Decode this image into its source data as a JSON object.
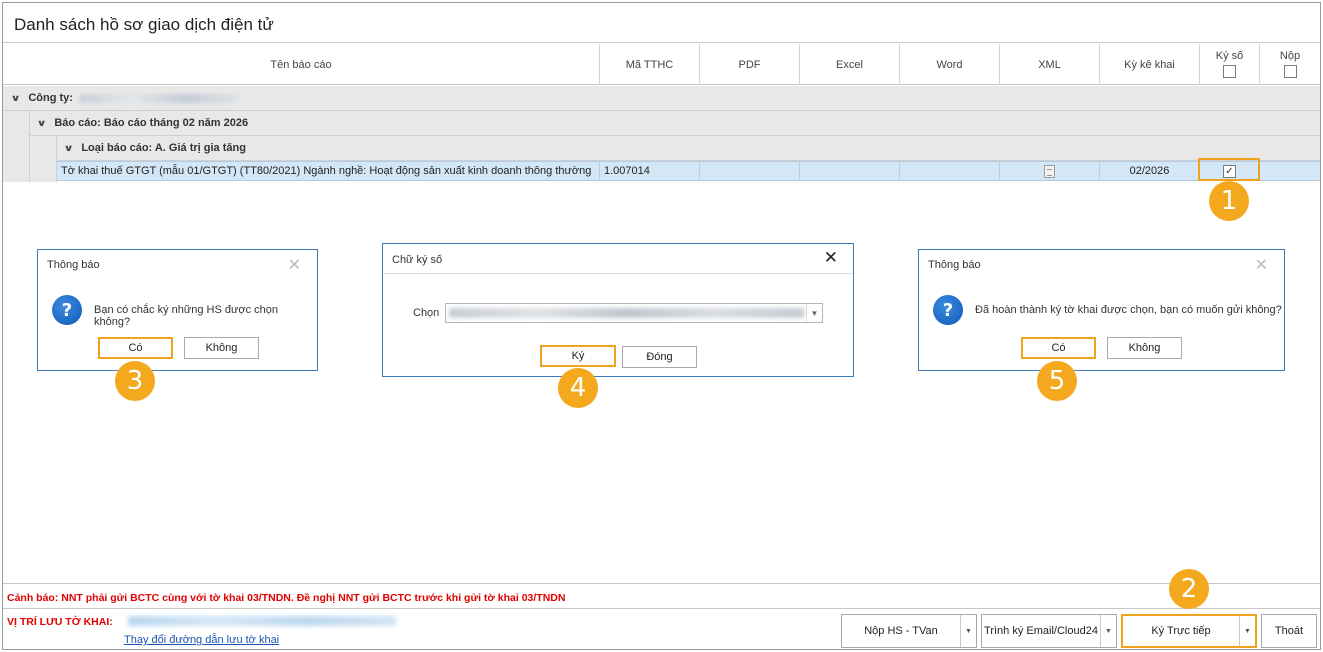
{
  "window": {
    "title": "Danh sách hồ sơ giao dịch điện tử"
  },
  "columns": {
    "ten_bao_cao": "Tên báo cáo",
    "ma_tthc": "Mã TTHC",
    "pdf": "PDF",
    "excel": "Excel",
    "word": "Word",
    "xml": "XML",
    "ky_ke_khai": "Kỳ kê khai",
    "ky_so": "Ký số",
    "nop": "Nộp"
  },
  "groups": {
    "cong_ty_label": "Công ty:",
    "bao_cao_label": "Báo cáo: Báo cáo tháng 02 năm 2026",
    "loai_bao_cao_label": "Loại báo cáo: A. Giá trị gia tăng"
  },
  "row": {
    "ten": "Tờ khai thuế GTGT (mẫu 01/GTGT) (TT80/2021) Ngành nghề: Hoạt động sản xuất kinh doanh thông thường",
    "ma_tthc": "1.007014",
    "ky_ke_khai": "02/2026",
    "ky_so_checked": "✓"
  },
  "badges": {
    "b1": "1",
    "b2": "2",
    "b3": "3",
    "b4": "4",
    "b5": "5"
  },
  "dialog1": {
    "title": "Thông báo",
    "message": "Bạn có chắc ký những HS được chọn không?",
    "yes": "Có",
    "no": "Không"
  },
  "dialog2": {
    "title": "Chữ ký số",
    "select_label": "Chọn",
    "sign": "Ký",
    "close": "Đóng"
  },
  "dialog3": {
    "title": "Thông báo",
    "message": "Đã hoàn thành ký tờ khai được chọn, bạn có muốn gửi không?",
    "yes": "Có",
    "no": "Không"
  },
  "footer": {
    "warning": "Cảnh báo: NNT phải gửi BCTC cùng với tờ khai 03/TNDN. Đề nghị NNT gửi BCTC trước khi gửi tờ khai 03/TNDN",
    "location_label": "VỊ TRÍ LƯU TỜ KHAI:",
    "change_path_link": "Thay đổi đường dẫn lưu tờ khai",
    "btn_nop": "Nộp HS - TVan",
    "btn_trinh_ky": "Trình ký Email/Cloud24",
    "btn_ky_truc_tiep": "Ký Trực tiếp",
    "btn_thoat": "Thoát"
  },
  "colors": {
    "accent": "#f0a21c",
    "badge": "#f4a81d",
    "warning": "#e00000",
    "selected_row": "#d3e7f6",
    "dialog_border": "#3f79b8"
  },
  "icons": [
    "chevron-down-icon",
    "question-icon",
    "close-icon",
    "document-icon",
    "dropdown-arrow-icon"
  ]
}
